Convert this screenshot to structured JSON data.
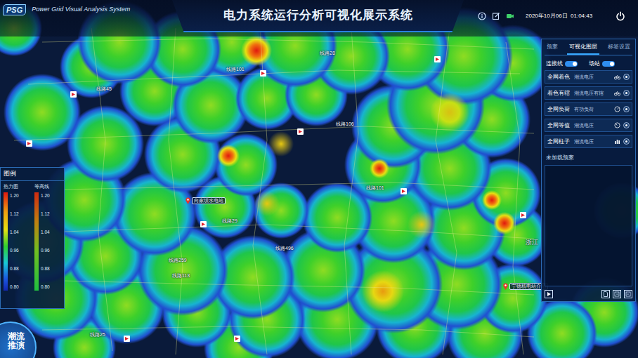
{
  "header": {
    "logo": "PSG",
    "subtitle": "Power Grid Visual Analysis System",
    "title": "电力系统运行分析可视化展示系统",
    "date": "2020年10月06日",
    "time": "01:04:43"
  },
  "panel": {
    "tabs": [
      {
        "label": "预案",
        "selected": false
      },
      {
        "label": "可视化图层",
        "selected": true
      },
      {
        "label": "标签设置",
        "selected": false
      }
    ],
    "toggles": [
      {
        "label": "连接线",
        "on": true
      },
      {
        "label": "场站",
        "on": true
      }
    ],
    "layers": [
      {
        "name": "全网着色",
        "value": "潮流电压"
      },
      {
        "name": "着色有辖",
        "value": "潮流电压有辖"
      },
      {
        "name": "全网负荷",
        "value": "有功负荷"
      },
      {
        "name": "全网等值",
        "value": "潮流电压"
      },
      {
        "name": "全网柱子",
        "value": "潮流电压"
      }
    ],
    "plan": {
      "title": "未加载预案"
    }
  },
  "legend": {
    "title": "图例",
    "scales": [
      {
        "label": "热力图",
        "kind": "heat",
        "ticks": [
          "1.20",
          "1.12",
          "1.04",
          "0.96",
          "0.88",
          "0.80"
        ]
      },
      {
        "label": "等高线",
        "kind": "contour",
        "ticks": [
          "1.20",
          "1.12",
          "1.04",
          "0.96",
          "0.88",
          "0.80"
        ]
      }
    ]
  },
  "map": {
    "labels": [
      {
        "text": "线路28",
        "kind": "line"
      },
      {
        "text": "线路101",
        "kind": "line"
      },
      {
        "text": "线路45",
        "kind": "line"
      },
      {
        "text": "线路106",
        "kind": "line"
      },
      {
        "text": "线路101",
        "kind": "line"
      },
      {
        "text": "线路29",
        "kind": "line"
      },
      {
        "text": "线路496",
        "kind": "line"
      },
      {
        "text": "线路259",
        "kind": "line"
      },
      {
        "text": "线路113",
        "kind": "line"
      },
      {
        "text": "线路25",
        "kind": "line"
      },
      {
        "text": "向家坝水电站",
        "kind": "station"
      },
      {
        "text": "宁德核电站介绍",
        "kind": "station"
      },
      {
        "text": "浙江",
        "kind": "region"
      }
    ]
  },
  "corner_button": "潮流推演"
}
